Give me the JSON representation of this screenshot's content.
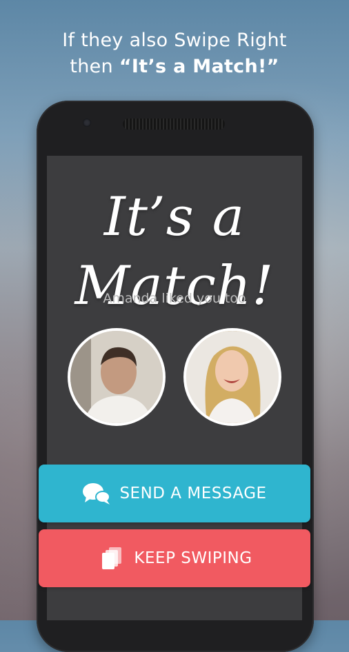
{
  "header": {
    "line1": "If they also Swipe Right",
    "line2_prefix": "then ",
    "line2_emphasis": "“It’s a Match!”"
  },
  "match": {
    "title": "It’s a Match!",
    "subtitle": "Amanda liked you too"
  },
  "avatars": {
    "left_icon": "user-avatar-male",
    "right_icon": "user-avatar-female"
  },
  "buttons": {
    "send_message": {
      "label": "SEND A MESSAGE",
      "icon": "chat-bubbles-icon",
      "color": "#2fb5cf"
    },
    "keep_swiping": {
      "label": "KEEP SWIPING",
      "icon": "cards-stack-icon",
      "color": "#f15a61"
    }
  }
}
